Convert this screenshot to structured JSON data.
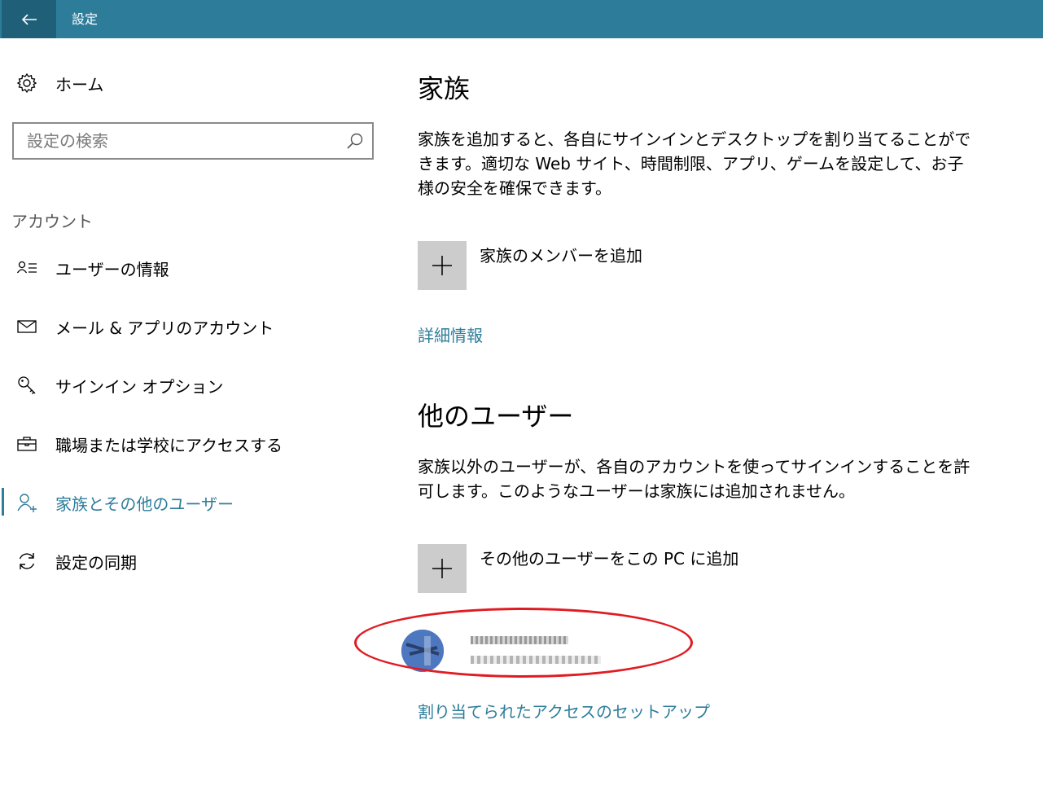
{
  "window": {
    "title": "設定"
  },
  "sidebar": {
    "home_label": "ホーム",
    "search_placeholder": "設定の検索",
    "section_label": "アカウント",
    "items": [
      {
        "label": "ユーザーの情報",
        "icon": "user-info-icon"
      },
      {
        "label": "メール & アプリのアカウント",
        "icon": "mail-icon"
      },
      {
        "label": "サインイン オプション",
        "icon": "key-icon"
      },
      {
        "label": "職場または学校にアクセスする",
        "icon": "briefcase-icon"
      },
      {
        "label": "家族とその他のユーザー",
        "icon": "add-person-icon",
        "selected": true
      },
      {
        "label": "設定の同期",
        "icon": "sync-icon"
      }
    ]
  },
  "main": {
    "family": {
      "heading": "家族",
      "description": "家族を追加すると、各自にサインインとデスクトップを割り当てることができます。適切な Web サイト、時間制限、アプリ、ゲームを設定して、お子様の安全を確保できます。",
      "add_label": "家族のメンバーを追加",
      "link_label": "詳細情報"
    },
    "other_users": {
      "heading": "他のユーザー",
      "description": "家族以外のユーザーが、各自のアカウントを使ってサインインすることを許可します。このようなユーザーは家族には追加されません。",
      "add_label": "その他のユーザーをこの PC に追加",
      "link_label": "割り当てられたアクセスのセットアップ"
    }
  },
  "colors": {
    "accent": "#2d7d9a",
    "titlebar": "#2d7d9a",
    "annotation": "#e01b22"
  }
}
